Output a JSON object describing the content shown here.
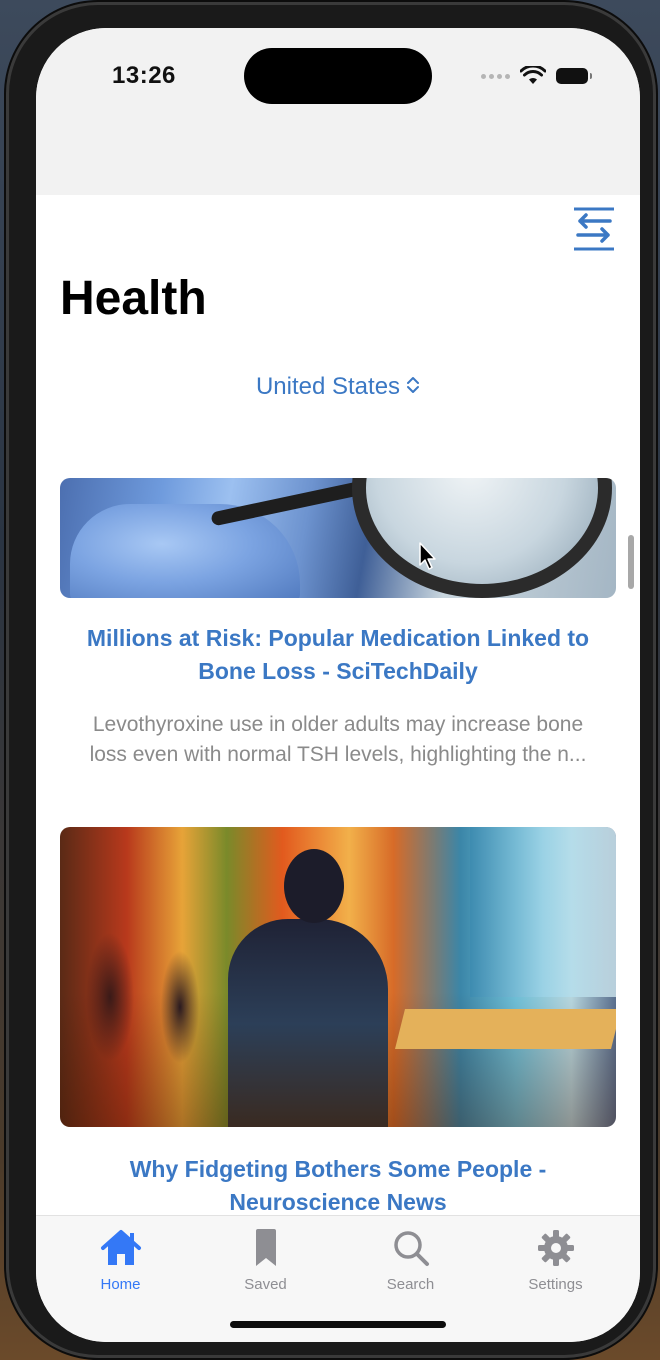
{
  "status_bar": {
    "time": "13:26"
  },
  "toolbar": {
    "filter_icon": "arrows-swap-icon"
  },
  "page": {
    "title": "Health"
  },
  "region_picker": {
    "value": "United States",
    "icon": "chevron-up-down-icon"
  },
  "articles": [
    {
      "headline": "Millions at Risk: Popular Medication Linked to Bone Loss - SciTechDaily",
      "summary_line1": "Levothyroxine use in older adults may increase bone",
      "summary_line2": "loss even with normal TSH levels, highlighting the n...",
      "image": "magnifying-glass-gloved-hand-photo"
    },
    {
      "headline": "Why Fidgeting Bothers Some People - Neuroscience News",
      "image": "colorful-cafe-silhouette-painting"
    }
  ],
  "tabbar": {
    "items": [
      {
        "label": "Home",
        "icon": "house-icon",
        "active": true
      },
      {
        "label": "Saved",
        "icon": "bookmark-icon",
        "active": false
      },
      {
        "label": "Search",
        "icon": "magnifying-glass-icon",
        "active": false
      },
      {
        "label": "Settings",
        "icon": "gear-icon",
        "active": false
      }
    ]
  },
  "colors": {
    "accent": "#3b78c4",
    "tab_active": "#3478f6",
    "tab_inactive": "#8e8e93",
    "summary_text": "#8a8a8a"
  }
}
